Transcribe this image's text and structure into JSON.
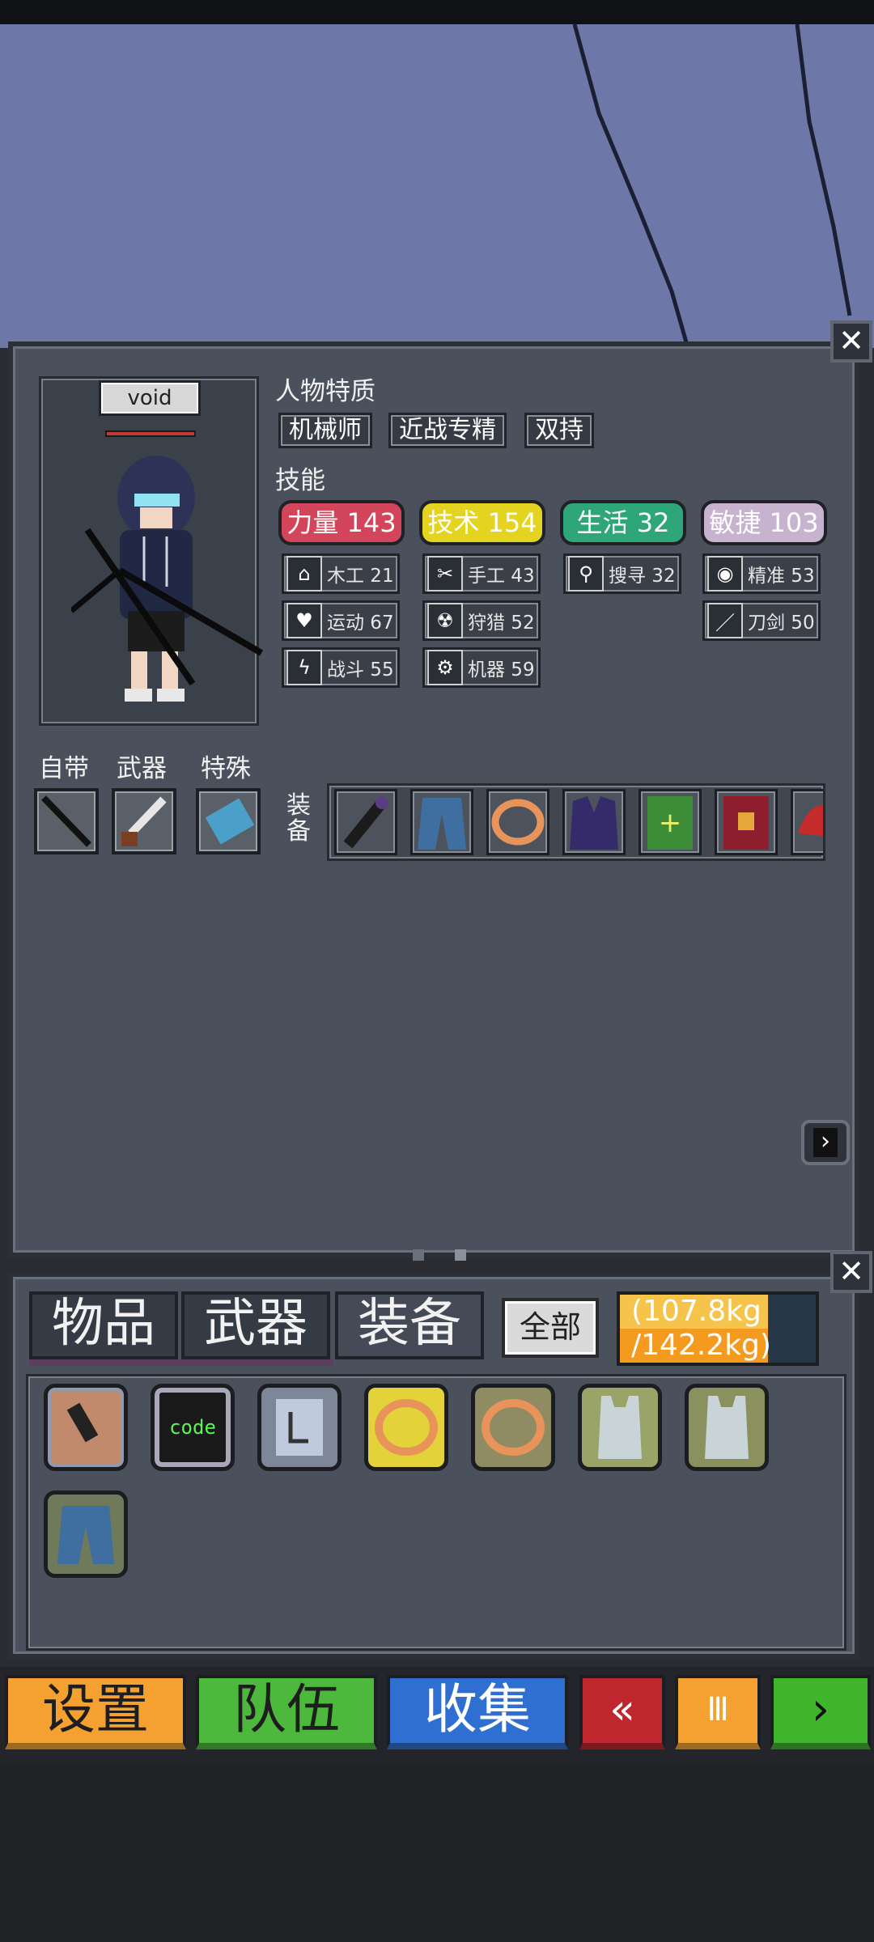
{
  "character": {
    "name": "void"
  },
  "traits": {
    "title": "人物特质",
    "items": [
      "机械师",
      "近战专精",
      "双持"
    ]
  },
  "skills": {
    "title": "技能",
    "stats": [
      {
        "label": "力量 143",
        "color": "#d3455a"
      },
      {
        "label": "技术 154",
        "color": "#e4d31f"
      },
      {
        "label": "生活 32",
        "color": "#2fa57a"
      },
      {
        "label": "敏捷 103",
        "color": "#c7b3d0"
      }
    ],
    "sub": [
      {
        "label": "木工 21",
        "icon": "house-icon"
      },
      {
        "label": "手工 43",
        "icon": "scissors-icon"
      },
      {
        "label": "搜寻 32",
        "icon": "magnifier-icon"
      },
      {
        "label": "精准 53",
        "icon": "eye-icon"
      },
      {
        "label": "运动 67",
        "icon": "heart-icon"
      },
      {
        "label": "狩猎 52",
        "icon": "radiation-icon"
      },
      {
        "label": "刀剑 50",
        "icon": "blade-icon"
      },
      {
        "label": "战斗 55",
        "icon": "lightning-icon"
      },
      {
        "label": "机器 59",
        "icon": "gear-icon"
      }
    ]
  },
  "slots": {
    "builtin": "自带",
    "weapon": "武器",
    "special": "特殊",
    "equipment": "装备"
  },
  "equipment": [
    "flashlight-icon",
    "jeans-icon",
    "ring-icon",
    "suit-jacket-icon",
    "green-book-icon",
    "red-book-icon",
    "red-hat-icon"
  ],
  "inventory": {
    "tabs": [
      "物品",
      "武器",
      "装备"
    ],
    "filter": "全部",
    "weight_current": "(107.8kg",
    "weight_max": "/142.2kg)",
    "weight_fraction": 0.758,
    "items": [
      {
        "icon": "pipe-icon",
        "bg": "#c18a6d",
        "text": ""
      },
      {
        "icon": "code-chip-icon",
        "bg": "#1a1a1a",
        "text": "code"
      },
      {
        "icon": "manual-icon",
        "bg": "#a9b6c8",
        "text": ""
      },
      {
        "icon": "gold-ring-icon",
        "bg": "#e3d23a",
        "text": ""
      },
      {
        "icon": "ring-icon",
        "bg": "#8f8b62",
        "text": ""
      },
      {
        "icon": "tank-top-icon",
        "bg": "#9aa468",
        "text": ""
      },
      {
        "icon": "tank-top-icon",
        "bg": "#8a915e",
        "text": ""
      },
      {
        "icon": "jeans-icon",
        "bg": "#6f7a5a",
        "text": ""
      }
    ]
  },
  "bottom_bar": {
    "settings": "设置",
    "team": "队伍",
    "collect": "收集",
    "back": "«",
    "pause": "Ⅲ",
    "next": "›"
  }
}
